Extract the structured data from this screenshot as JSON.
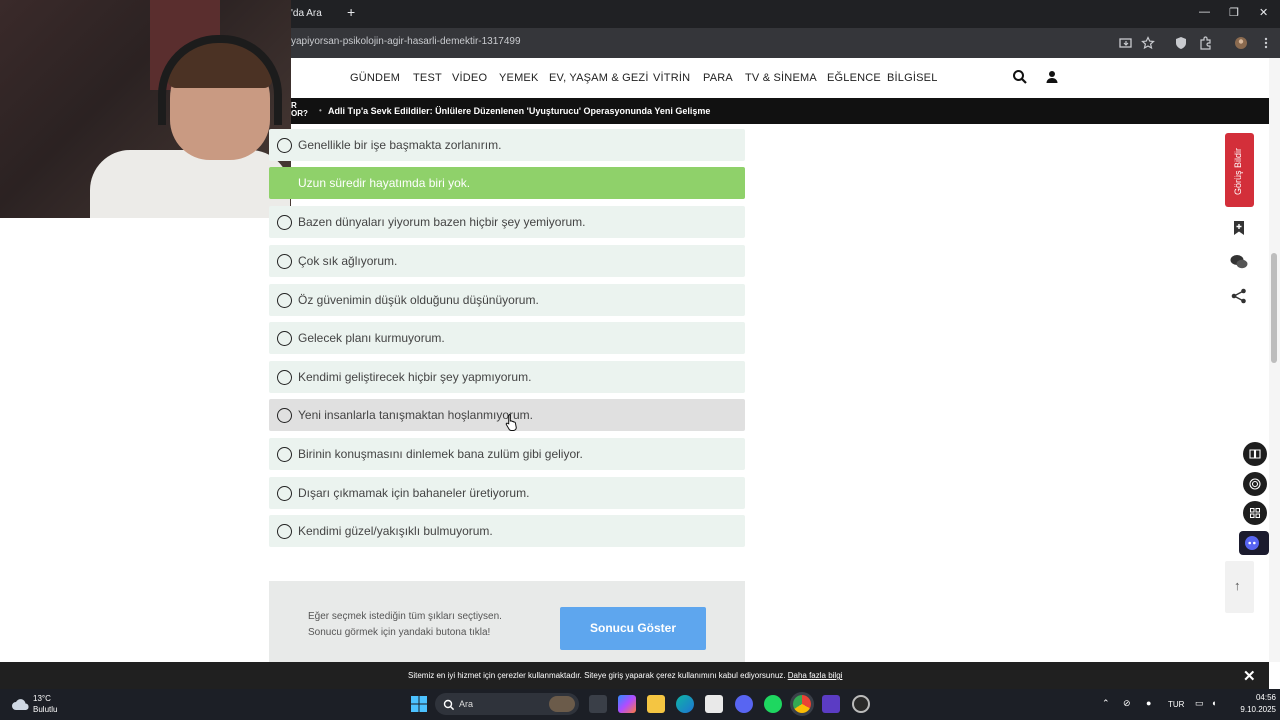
{
  "browser": {
    "tab_title": "'da Ara",
    "new_tab": "+",
    "url": "yapiyorsan-psikolojin-agir-hasarli-demektir-1317499",
    "window_controls": [
      "—",
      "❐",
      "✕"
    ]
  },
  "nav": {
    "items": [
      "GÜNDEM",
      "TEST",
      "VİDEO",
      "YEMEK",
      "EV, YAŞAM & GEZİ",
      "VİTRİN",
      "PARA",
      "TV & SİNEMA",
      "EĞLENCE",
      "BİLGİSEL"
    ],
    "icons": [
      "search-icon",
      "user-icon"
    ]
  },
  "ticker": {
    "tag": "R\nOR?",
    "bullet": "•",
    "headline": "Adli Tıp'a Sevk Edildiler: Ünlülere Düzenlenen 'Uyuşturucu' Operasyonunda Yeni Gelişme"
  },
  "quiz": {
    "options": [
      {
        "text": "Genellikle bir işe başmakta zorlanırım.",
        "state": "normal"
      },
      {
        "text": "Uzun süredir hayatımda biri yok.",
        "state": "selected"
      },
      {
        "text": "Bazen dünyaları yiyorum bazen hiçbir şey yemiyorum.",
        "state": "normal"
      },
      {
        "text": "Çok sık ağlıyorum.",
        "state": "normal"
      },
      {
        "text": "Öz güvenimin düşük olduğunu düşünüyorum.",
        "state": "normal"
      },
      {
        "text": "Gelecek planı kurmuyorum.",
        "state": "normal"
      },
      {
        "text": "Kendimi geliştirecek hiçbir şey yapmıyorum.",
        "state": "normal"
      },
      {
        "text": "Yeni insanlarla tanışmaktan hoşlanmıyorum.",
        "state": "hover"
      },
      {
        "text": "Birinin konuşmasını dinlemek bana zulüm gibi geliyor.",
        "state": "normal"
      },
      {
        "text": "Dışarı çıkmamak için bahaneler üretiyorum.",
        "state": "normal"
      },
      {
        "text": "Kendimi güzel/yakışıklı bulmuyorum.",
        "state": "normal"
      }
    ],
    "result_prompt": "Eğer seçmek istediğin tüm şıkları seçtiysen. Sonucu görmek için yandaki butona tıkla!",
    "result_button": "Sonucu Göster"
  },
  "rail": {
    "feedback": "Görüş Bildir",
    "icons": [
      "bookmark-icon",
      "comments-icon",
      "share-icon"
    ],
    "floating": [
      "book-icon",
      "fingerprint-icon",
      "apps-icon",
      "discord-icon"
    ],
    "to_top": "↑"
  },
  "cookie": {
    "text": "Sitemiz en iyi hizmet için çerezler kullanmaktadır. Siteye giriş yaparak çerez kullanımını kabul ediyorsunuz.",
    "link": "Daha fazla bilgi",
    "close": "✕"
  },
  "taskbar": {
    "weather_temp": "13°C",
    "weather_desc": "Bulutlu",
    "search_placeholder": "Ara",
    "language": "TUR",
    "time": "04:56",
    "date": "9.10.2025"
  },
  "colors": {
    "selected_option": "#8fd16a",
    "option_bg": "#ebf3ef",
    "button": "#5ea6ee",
    "feedback": "#d32f3a"
  }
}
